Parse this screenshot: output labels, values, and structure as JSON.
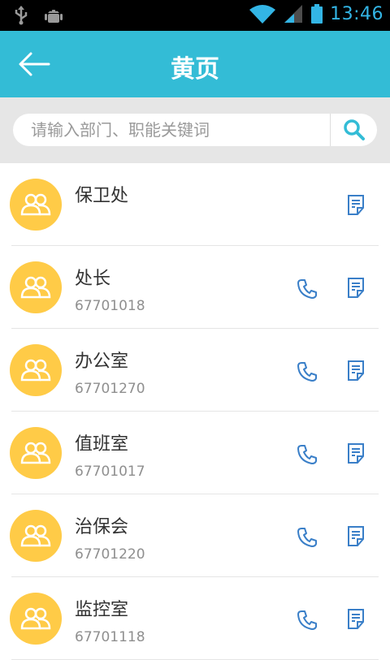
{
  "status_bar": {
    "time": "13:46"
  },
  "header": {
    "title": "黄页"
  },
  "search": {
    "placeholder": "请输入部门、职能关键词"
  },
  "contacts": [
    {
      "name": "保卫处",
      "phone": ""
    },
    {
      "name": "处长",
      "phone": "67701018"
    },
    {
      "name": "办公室",
      "phone": "67701270"
    },
    {
      "name": "值班室",
      "phone": "67701017"
    },
    {
      "name": "治保会",
      "phone": "67701220"
    },
    {
      "name": "监控室",
      "phone": "67701118"
    }
  ],
  "icons": {
    "back": "back-arrow-icon",
    "search": "search-icon",
    "call": "phone-icon",
    "note": "note-icon",
    "avatar": "group-avatar-icon"
  },
  "colors": {
    "header_bg": "#33bcd6",
    "avatar_bg": "#ffcb47",
    "icon_blue": "#3a7fc8",
    "search_area_bg": "#e6e6e6"
  }
}
